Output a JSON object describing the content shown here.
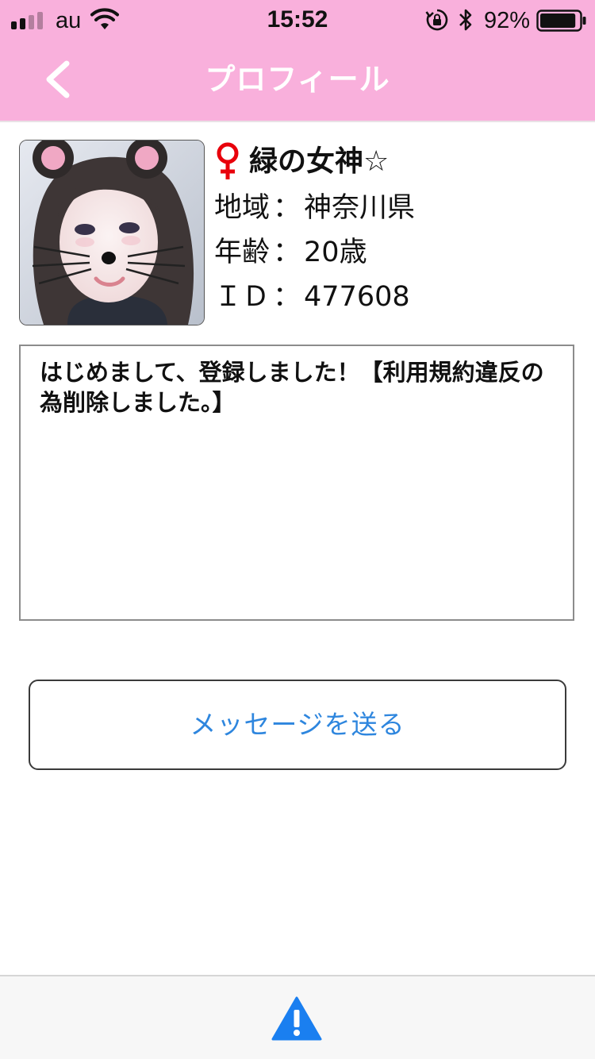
{
  "status_bar": {
    "carrier": "au",
    "time": "15:52",
    "battery_percent": "92%",
    "battery_level": 0.92,
    "signal_bars": 2,
    "icons": [
      "signal-icon",
      "wifi-icon",
      "orientation-lock-icon",
      "bluetooth-icon",
      "battery-icon"
    ]
  },
  "nav": {
    "title": "プロフィール",
    "back_icon": "chevron-left-icon"
  },
  "profile": {
    "gender_icon": "female-symbol-icon",
    "name": "緑の女神☆",
    "region_label": "地域",
    "region_value": "神奈川県",
    "age_label": "年齢",
    "age_value": "20歳",
    "id_label": "ＩＤ",
    "id_value": "477608",
    "separator": "："
  },
  "bio": {
    "text": "はじめまして、登録しました！【利用規約違反の為削除しました。】"
  },
  "actions": {
    "send_message_label": "メッセージを送る"
  },
  "footer": {
    "report_icon": "warning-icon"
  },
  "colors": {
    "header_bg": "#f9b0dc",
    "link_blue": "#2e86de",
    "female_red": "#e8000b",
    "warning_blue": "#1a7ff0"
  }
}
